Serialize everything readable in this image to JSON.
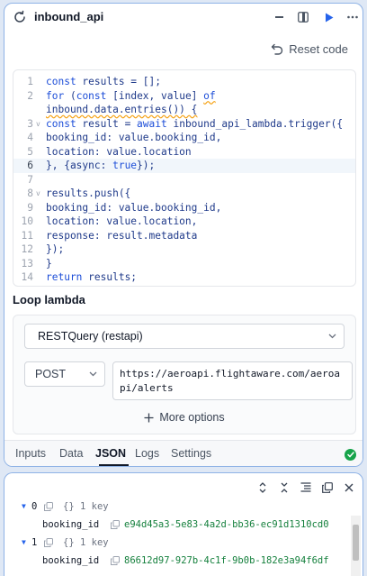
{
  "header": {
    "title": "inbound_api",
    "minimize_label": "–"
  },
  "reset_code": {
    "label": "Reset code"
  },
  "editor": {
    "lines": [
      {
        "n": "1",
        "fold": false
      },
      {
        "n": "2",
        "fold": true
      },
      {
        "n": "3",
        "fold": true
      },
      {
        "n": "4",
        "fold": false
      },
      {
        "n": "5",
        "fold": false
      },
      {
        "n": "6",
        "fold": false
      },
      {
        "n": "7",
        "fold": false
      },
      {
        "n": "8",
        "fold": true
      },
      {
        "n": "9",
        "fold": false
      },
      {
        "n": "10",
        "fold": false
      },
      {
        "n": "11",
        "fold": false
      },
      {
        "n": "12",
        "fold": false
      },
      {
        "n": "13",
        "fold": false
      },
      {
        "n": "14",
        "fold": false
      }
    ],
    "code": {
      "l1a": "const",
      "l1b": " results = [];",
      "l2a": "for",
      "l2b": " (",
      "l2c": "const",
      "l2d": " [index, value] ",
      "l2e": "of",
      "l2w": "inbound.data.entries()) {",
      "l3a": "const",
      "l3b": " result = ",
      "l3c": "await",
      "l3d": " inbound_api_lambda.trigger({",
      "l4": "booking_id: value.booking_id,",
      "l5": "location: value.location",
      "l6a": "}, {async: ",
      "l6b": "true",
      "l6c": "});",
      "l8": "results.push({",
      "l9": "booking_id: value.booking_id,",
      "l10": "location: value.location,",
      "l11": "response: result.metadata",
      "l12": "});",
      "l13": "}",
      "l14a": "return",
      "l14b": " results;"
    },
    "active_line": 6
  },
  "loop_lambda": {
    "label": "Loop lambda",
    "source": "RESTQuery (restapi)",
    "method": "POST",
    "url": "https://aeroapi.flightaware.com/aeroapi/alerts",
    "more_options": "More options"
  },
  "tabs": [
    {
      "label": "Inputs",
      "active": false
    },
    {
      "label": "Data",
      "active": false
    },
    {
      "label": "JSON",
      "active": true
    },
    {
      "label": "Logs",
      "active": false
    },
    {
      "label": "Settings",
      "active": false
    }
  ],
  "json_view": {
    "items": [
      {
        "index": "0",
        "type": "{}",
        "count": "1 key",
        "key": "booking_id",
        "value": "e94d45a3-5e83-4a2d-bb36-ec91d1310cd0"
      },
      {
        "index": "1",
        "type": "{}",
        "count": "1 key",
        "key": "booking_id",
        "value": "86612d97-927b-4c1f-9b0b-182e3a94f6df"
      }
    ]
  },
  "colors": {
    "accent": "#2563eb",
    "success": "#16a34a",
    "json_value": "#15803d",
    "panel_border": "#8fb3e6"
  }
}
